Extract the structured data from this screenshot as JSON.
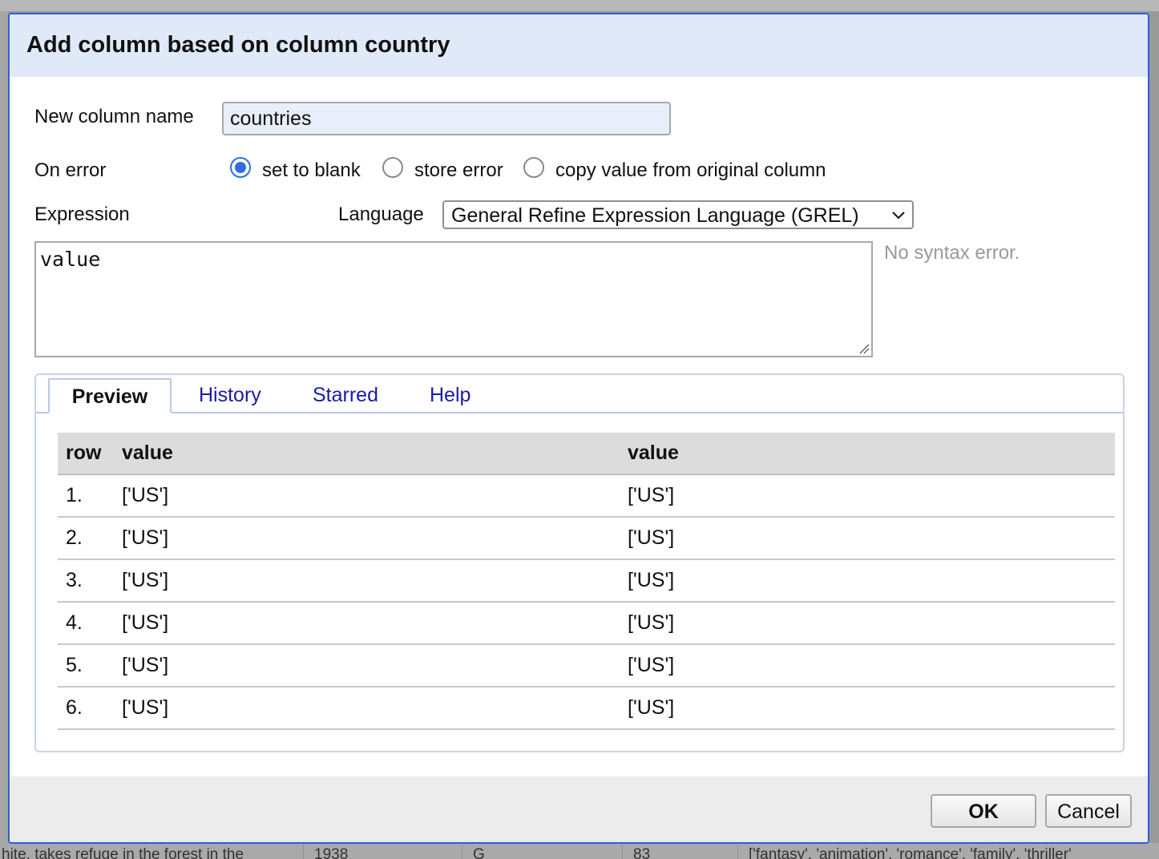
{
  "background": {
    "bottom_row_cells": [
      "hite, takes refuge in the forest in the",
      "1938",
      "G",
      "83",
      "['fantasy', 'animation', 'romance', 'family', 'thriller'"
    ]
  },
  "dialog": {
    "title": "Add column based on column country",
    "new_column_label": "New column name",
    "new_column_value": "countries",
    "on_error_label": "On error",
    "on_error_options": [
      "set to blank",
      "store error",
      "copy value from original column"
    ],
    "on_error_selected": "set to blank",
    "expression_label": "Expression",
    "language_label": "Language",
    "language_value": "General Refine Expression Language (GREL)",
    "expression_value": "value",
    "syntax_status": "No syntax error.",
    "tabs": [
      "Preview",
      "History",
      "Starred",
      "Help"
    ],
    "active_tab": "Preview",
    "preview": {
      "headers": [
        "row",
        "value",
        "value"
      ],
      "rows": [
        [
          "1.",
          "['US']",
          "['US']"
        ],
        [
          "2.",
          "['US']",
          "['US']"
        ],
        [
          "3.",
          "['US']",
          "['US']"
        ],
        [
          "4.",
          "['US']",
          "['US']"
        ],
        [
          "5.",
          "['US']",
          "['US']"
        ],
        [
          "6.",
          "['US']",
          "['US']"
        ]
      ]
    },
    "ok_label": "OK",
    "cancel_label": "Cancel"
  },
  "colors": {
    "accent": "#2f6de1",
    "dialog_border": "#2e5fd6",
    "header_bg": "#dfe9f8",
    "tab_link": "#1a1aa6"
  }
}
